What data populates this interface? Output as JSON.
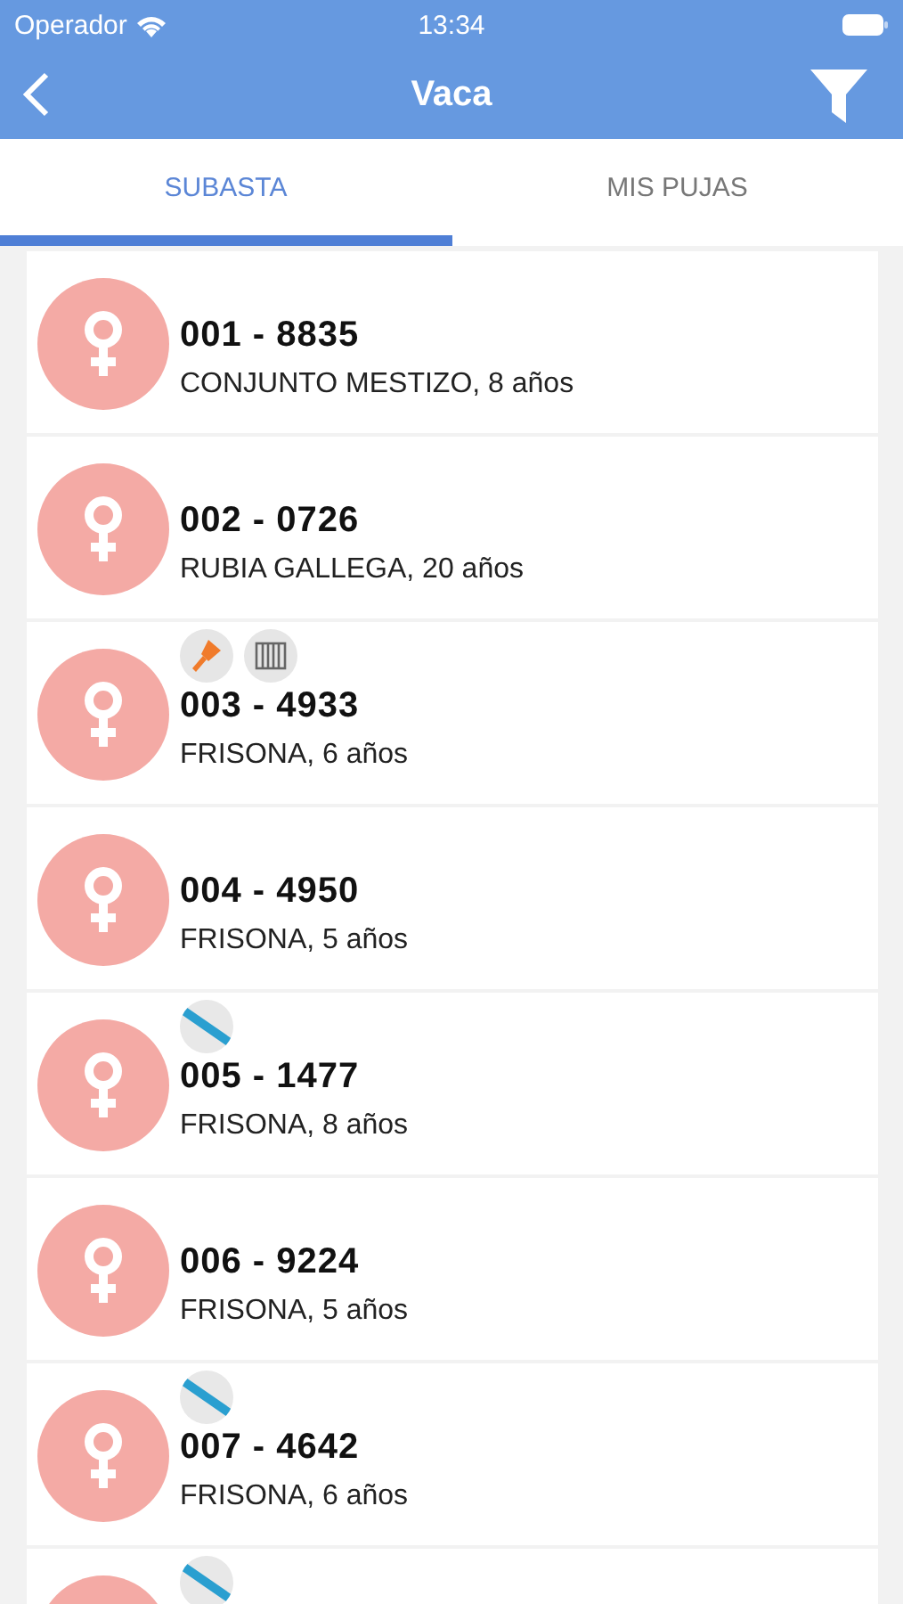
{
  "status_bar": {
    "carrier": "Operador",
    "time": "13:34"
  },
  "nav": {
    "title": "Vaca"
  },
  "tabs": [
    {
      "label": "SUBASTA",
      "selected": true
    },
    {
      "label": "MIS PUJAS",
      "selected": false
    }
  ],
  "animals": [
    {
      "title": "001 - 8835",
      "subtitle": "CONJUNTO MESTIZO, 8 años"
    },
    {
      "title": "002 - 0726",
      "subtitle": "RUBIA GALLEGA, 20 años"
    },
    {
      "title": "003 - 4933",
      "subtitle": "FRISONA, 6 años",
      "badges": [
        {
          "kind": "cleaver"
        },
        {
          "kind": "fence"
        }
      ]
    },
    {
      "title": "004 - 4950",
      "subtitle": "FRISONA, 5 años"
    },
    {
      "title": "005 - 1477",
      "subtitle": "FRISONA, 8 años",
      "badges": [
        {
          "kind": "flag"
        }
      ]
    },
    {
      "title": "006 - 9224",
      "subtitle": "FRISONA, 5 años"
    },
    {
      "title": "007 - 4642",
      "subtitle": "FRISONA, 6 años",
      "badges": [
        {
          "kind": "flag"
        }
      ]
    },
    {
      "badges": [
        {
          "kind": "flag"
        }
      ]
    }
  ]
}
